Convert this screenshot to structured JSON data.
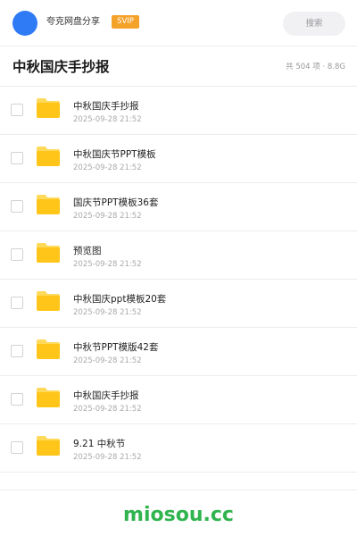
{
  "header": {
    "app_name": "夸克网盘分享",
    "vip_badge": "SVIP",
    "search_label": "搜索"
  },
  "title_bar": {
    "title": "中秋国庆手抄报",
    "meta": "共 504 项 · 8.8G"
  },
  "items": [
    {
      "name": "中秋国庆手抄报",
      "date": "2025-09-28 21:52"
    },
    {
      "name": "中秋国庆节PPT模板",
      "date": "2025-09-28 21:52"
    },
    {
      "name": "国庆节PPT模板36套",
      "date": "2025-09-28 21:52"
    },
    {
      "name": "预览图",
      "date": "2025-09-28 21:52"
    },
    {
      "name": "中秋国庆ppt模板20套",
      "date": "2025-09-28 21:52"
    },
    {
      "name": "中秋节PPT模版42套",
      "date": "2025-09-28 21:52"
    },
    {
      "name": "中秋国庆手抄报",
      "date": "2025-09-28 21:52"
    },
    {
      "name": "9.21 中秋节",
      "date": "2025-09-28 21:52"
    }
  ],
  "footer": {
    "brand": "miosou.cc"
  },
  "colors": {
    "avatar": "#2f7bf6",
    "vip": "#f5a22b",
    "folder": "#ffc619",
    "brand": "#2fb44e"
  },
  "icons": {
    "folder": "folder-icon",
    "checkbox": "checkbox-icon"
  }
}
